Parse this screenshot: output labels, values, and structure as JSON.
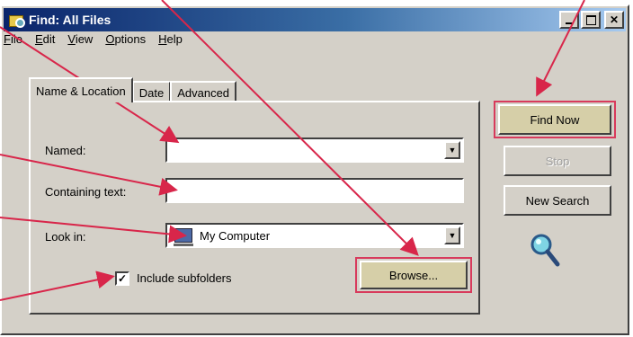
{
  "window": {
    "title": "Find: All Files"
  },
  "menu": [
    {
      "label": "File",
      "mnemonic": "F"
    },
    {
      "label": "Edit",
      "mnemonic": "E"
    },
    {
      "label": "View",
      "mnemonic": "V"
    },
    {
      "label": "Options",
      "mnemonic": "O"
    },
    {
      "label": "Help",
      "mnemonic": "H"
    }
  ],
  "tabs": [
    {
      "label": "Name & Location",
      "active": true
    },
    {
      "label": "Date",
      "active": false
    },
    {
      "label": "Advanced",
      "active": false
    }
  ],
  "form": {
    "named_label": "Named:",
    "named_value": "",
    "containing_label": "Containing text:",
    "containing_value": "",
    "lookin_label": "Look in:",
    "lookin_value": "My Computer",
    "include_subfolders_label": "Include subfolders",
    "include_subfolders_checked": true,
    "browse_label": "Browse..."
  },
  "buttons": {
    "find_now": "Find Now",
    "stop": "Stop",
    "new_search": "New Search"
  },
  "icons": [
    "app-find-icon",
    "minimize-icon",
    "maximize-icon",
    "close-icon",
    "computer-icon",
    "dropdown-arrow-icon",
    "magnifier-icon"
  ],
  "colors": {
    "annotation_arrow": "#d8264a",
    "highlight_box": "#d83a5c",
    "title_gradient_start": "#0a246a"
  }
}
